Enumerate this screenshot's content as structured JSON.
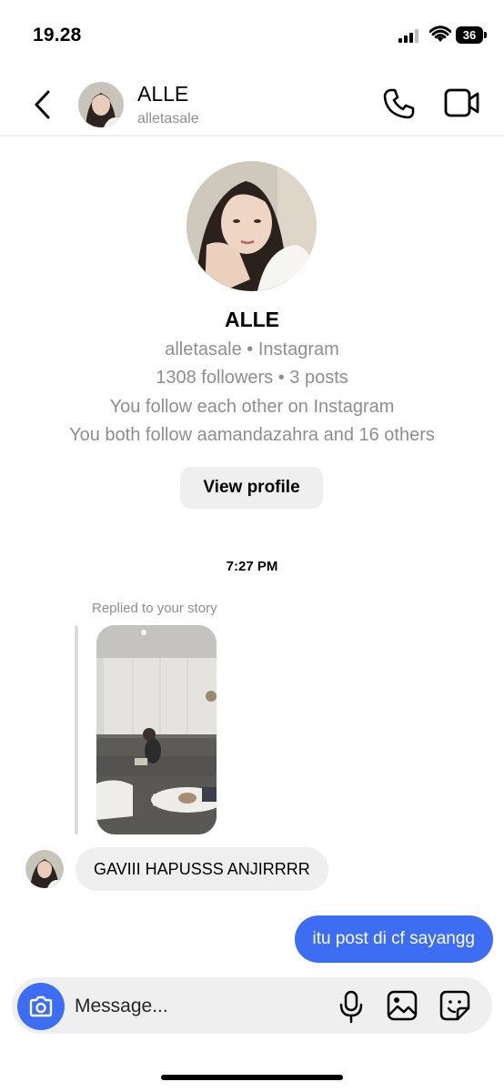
{
  "status_bar": {
    "time": "19.28",
    "battery": "36"
  },
  "header": {
    "name": "ALLE",
    "username": "alletasale"
  },
  "profile": {
    "name": "ALLE",
    "handle_line": "alletasale • Instagram",
    "stats_line": "1308 followers • 3 posts",
    "mutual_line": "You follow each other on Instagram",
    "mutuals_line": "You both follow aamandazahra and 16 others",
    "view_profile_label": "View profile"
  },
  "thread": {
    "timestamp": "7:27 PM",
    "story_reply_label": "Replied to your story",
    "incoming_message": "GAVIII HAPUSSS ANJIRRRR",
    "outgoing_message": "itu post di cf sayangg"
  },
  "composer": {
    "placeholder": "Message..."
  },
  "icons": {
    "back": "chevron-left-icon",
    "call": "phone-icon",
    "video": "video-camera-icon",
    "camera": "camera-icon",
    "mic": "microphone-icon",
    "gallery": "image-icon",
    "sticker": "sticker-icon"
  },
  "colors": {
    "accent": "#3d6df2",
    "bubble_in": "#efefef",
    "muted_text": "#8e8e8e"
  }
}
